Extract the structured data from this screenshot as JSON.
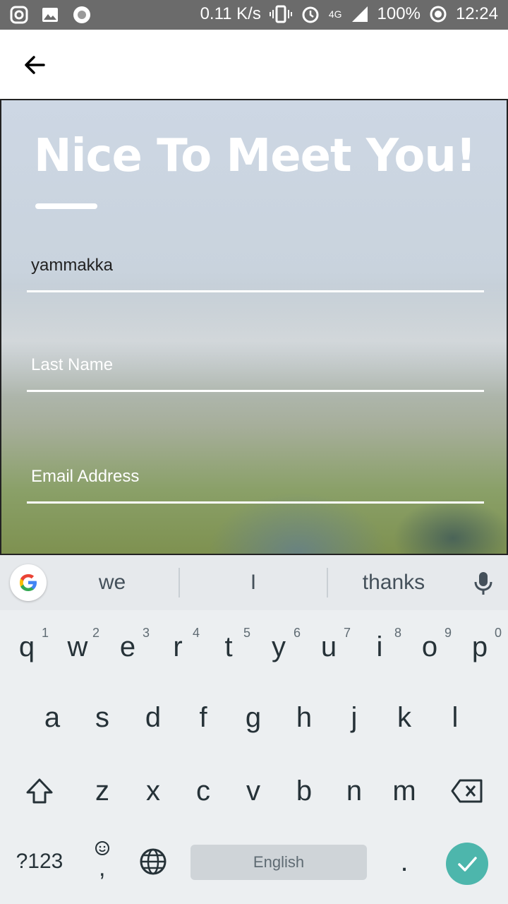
{
  "status_bar": {
    "speed": "0.11 K/s",
    "network": "4G",
    "battery": "100%",
    "time": "12:24",
    "icons": [
      "instagram-icon",
      "gallery-icon",
      "record-icon",
      "vibrate-icon",
      "alarm-icon",
      "signal-icon",
      "battery-ring-icon"
    ]
  },
  "app_bar": {
    "back_icon": "arrow-left-icon"
  },
  "form": {
    "title": "Nice To Meet You!",
    "first_name_value": "yammakka",
    "last_name_placeholder": "Last Name",
    "email_placeholder": "Email Address"
  },
  "keyboard": {
    "suggestions": [
      "we",
      "I",
      "thanks"
    ],
    "row1": [
      {
        "label": "q",
        "hint": "1"
      },
      {
        "label": "w",
        "hint": "2"
      },
      {
        "label": "e",
        "hint": "3"
      },
      {
        "label": "r",
        "hint": "4"
      },
      {
        "label": "t",
        "hint": "5"
      },
      {
        "label": "y",
        "hint": "6"
      },
      {
        "label": "u",
        "hint": "7"
      },
      {
        "label": "i",
        "hint": "8"
      },
      {
        "label": "o",
        "hint": "9"
      },
      {
        "label": "p",
        "hint": "0"
      }
    ],
    "row2": [
      "a",
      "s",
      "d",
      "f",
      "g",
      "h",
      "j",
      "k",
      "l"
    ],
    "row3": [
      "z",
      "x",
      "c",
      "v",
      "b",
      "n",
      "m"
    ],
    "symbols_label": "?123",
    "comma_label": ",",
    "space_label": "English",
    "period_label": ".",
    "accent_color": "#4db6ac"
  }
}
